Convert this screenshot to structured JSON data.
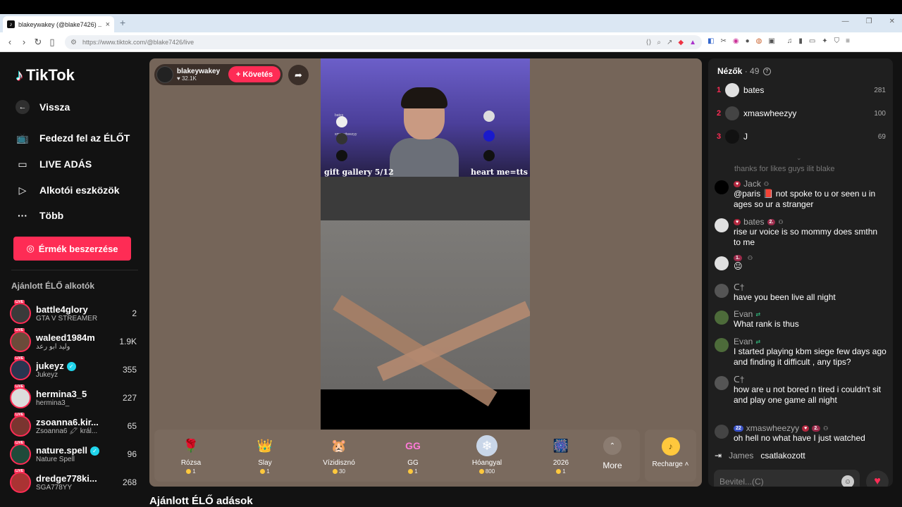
{
  "browser": {
    "tab_title": "blakeywakey (@blake7426) ...",
    "url": "https://www.tiktok.com/@blake7426/live"
  },
  "sidebar": {
    "logo": "TikTok",
    "back": "Vissza",
    "nav": [
      "Fedezd fel az ÉLŐT",
      "LIVE ADÁS",
      "Alkotói eszközök",
      "Több"
    ],
    "coins_button": "Érmék beszerzése",
    "section_title": "Ajánlott ÉLŐ alkotók",
    "live_tag": "LIVE",
    "creators": [
      {
        "name": "battle4glory",
        "sub": "GTA V STREAMER",
        "count": "2",
        "verified": false,
        "color": "#3a3a3a"
      },
      {
        "name": "waleed1984m",
        "sub": "وليد ابو رعد",
        "count": "1.9K",
        "verified": false,
        "color": "#6b4b3a"
      },
      {
        "name": "jukeyz",
        "sub": "Jukeyz",
        "count": "355",
        "verified": true,
        "color": "#2a3550"
      },
      {
        "name": "hermina3_5",
        "sub": "hermina3_",
        "count": "227",
        "verified": false,
        "color": "#dcdcdc"
      },
      {
        "name": "zsoanna6.kir...",
        "sub": "Zsoanna6 🖍 král...",
        "count": "65",
        "verified": false,
        "color": "#7a3530"
      },
      {
        "name": "nature.spell",
        "sub": "Nature Spell",
        "count": "96",
        "verified": true,
        "color": "#1f4a3a"
      },
      {
        "name": "dredge778ki...",
        "sub": "SGA778YY",
        "count": "268",
        "verified": false,
        "color": "#a33"
      }
    ]
  },
  "stage": {
    "host_name": "blakeywakey",
    "host_likes": "32.1K",
    "follow": "+ Követés",
    "video": {
      "caption_left": "gift gallery 5/12",
      "caption_right": "heart me=tts",
      "board_names": [
        "bates",
        "xmaswheezyy"
      ]
    },
    "gifts": [
      {
        "name": "Rózsa",
        "price": "1",
        "icon": "🌹",
        "bg": "transparent"
      },
      {
        "name": "Slay",
        "price": "1",
        "icon": "👑",
        "bg": "transparent"
      },
      {
        "name": "Vízidisznó",
        "price": "30",
        "icon": "🐹",
        "bg": "transparent"
      },
      {
        "name": "GG",
        "price": "1",
        "icon": "GG",
        "bg": "transparent"
      },
      {
        "name": "Hóangyal",
        "price": "800",
        "icon": "❄",
        "bg": "#c9d6e8"
      },
      {
        "name": "2026",
        "price": "1",
        "icon": "🎆",
        "bg": "transparent"
      }
    ],
    "more": "More",
    "recharge": "Recharge"
  },
  "recommended_title": "Ajánlott ÉLŐ adások",
  "chat": {
    "viewers_label": "Nézők",
    "viewers_count": "· 49",
    "top_viewers": [
      {
        "rank": "1",
        "name": "bates",
        "score": "281",
        "color": "#e0e0e0"
      },
      {
        "rank": "2",
        "name": "xmaswheezyy",
        "score": "100",
        "color": "#444"
      },
      {
        "rank": "3",
        "name": "J",
        "score": "69",
        "color": "#111"
      }
    ],
    "faded_msg": "thanks for likes guys ilit blake",
    "messages": [
      {
        "user": "Jack",
        "badges": [
          "heart"
        ],
        "text": "@paris 📕 not spoke to u or seen u in ages so ur a stranger",
        "color": "#000"
      },
      {
        "user": "bates",
        "badges": [
          "heart",
          "lvl2"
        ],
        "text": "rise ur voice is so mommy does smthn to me",
        "color": "#e0e0e0"
      },
      {
        "user": "",
        "badges": [
          "lvl1"
        ],
        "text": "😐",
        "color": "#e0e0e0"
      },
      {
        "user": "ᑕ†",
        "badges": [],
        "text": "have you been live all night",
        "color": "#555"
      },
      {
        "user": "Evan",
        "badges": [
          "sub"
        ],
        "text": "What rank is thus",
        "color": "#4d6b3a"
      },
      {
        "user": "Evan",
        "badges": [
          "sub"
        ],
        "text": "I started playing kbm siege few days ago and finding it difficult , any tips?",
        "color": "#4d6b3a"
      },
      {
        "user": "ᑕ†",
        "badges": [],
        "text": "how are u not bored n tired i couldn't sit and play one game all night",
        "color": "#555"
      },
      {
        "user": "xmaswheezyy",
        "badges": [
          "blue22",
          "heart",
          "lvl2"
        ],
        "text": "oh hell no what have I just watched",
        "color": "#444"
      }
    ],
    "join_user": "James",
    "join_text": "csatlakozott",
    "input_placeholder": "Bevitel...(C)",
    "badge_texts": {
      "lvl1": "1.",
      "lvl2": "2.",
      "blue22": "22"
    }
  }
}
